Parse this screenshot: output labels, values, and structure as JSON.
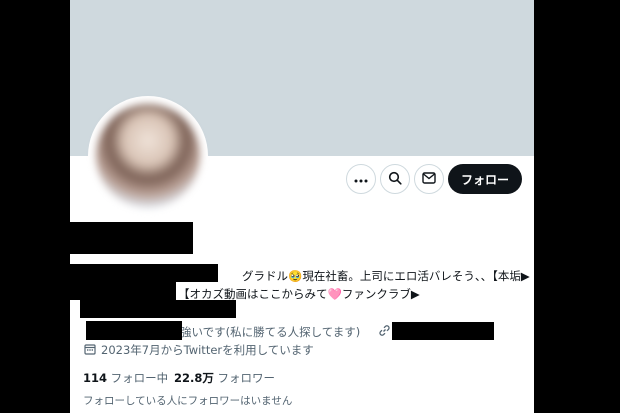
{
  "profile": {
    "bio_line1": "グラドル🥹現在社畜。上司にエロ活バレそう、、【本垢▶",
    "bio_line2": "【オカズ動画はここからみて🩷ファンクラブ▶",
    "location_text": "強いです(私に勝てる人探してます)",
    "joined": "2023年7月からTwitterを利用しています",
    "following_count": "114",
    "following_label": "フォロー中",
    "followers_count": "22.8万",
    "followers_label": "フォロワー",
    "no_common_followers": "フォローしている人にフォロワーはいません"
  },
  "actions": {
    "more_icon": "more-icon",
    "search_icon": "search-icon",
    "message_icon": "mail-icon",
    "follow_label": "フォロー"
  },
  "colors": {
    "banner": "#cfd9de",
    "follow_button": "#0f1419",
    "muted_text": "#536471"
  }
}
